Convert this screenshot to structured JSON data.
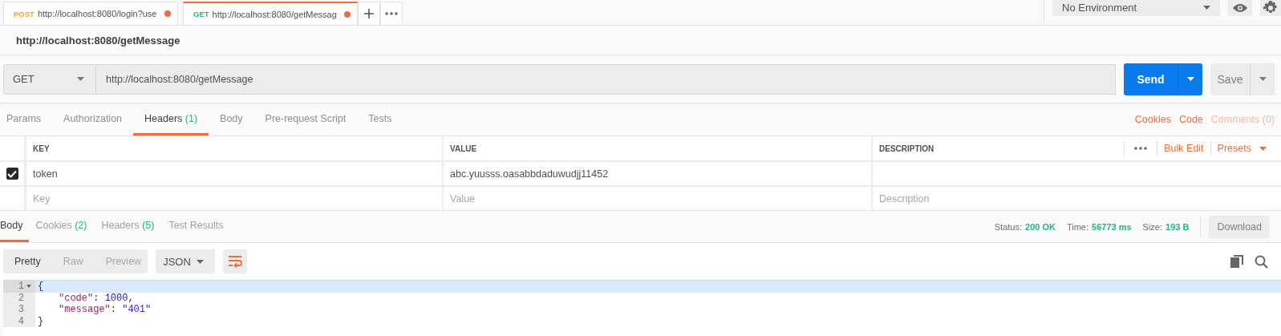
{
  "tabs": [
    {
      "method": "POST",
      "color": "#f5a623",
      "url": "http://localhost:8080/login?use",
      "unsaved": true,
      "selected": false
    },
    {
      "method": "GET",
      "color": "#26b47f",
      "url": "http://localhost:8080/getMessag",
      "unsaved": true,
      "selected": true
    }
  ],
  "environment": {
    "value": "No Environment"
  },
  "request": {
    "title": "http://localhost:8080/getMessage",
    "method": "GET",
    "url": "http://localhost:8080/getMessage",
    "send": "Send",
    "save": "Save"
  },
  "request_tabs": [
    {
      "label": "Params",
      "selected": false
    },
    {
      "label": "Authorization",
      "selected": false
    },
    {
      "label": "Headers",
      "count": "(1)",
      "selected": true
    },
    {
      "label": "Body",
      "selected": false
    },
    {
      "label": "Pre-request Script",
      "selected": false
    },
    {
      "label": "Tests",
      "selected": false
    }
  ],
  "request_links": [
    {
      "label": "Cookies",
      "disabled": false
    },
    {
      "label": "Code",
      "disabled": false
    },
    {
      "label": "Comments (0)",
      "disabled": true
    }
  ],
  "headers_table": {
    "columns": [
      "KEY",
      "VALUE",
      "DESCRIPTION"
    ],
    "bulk_edit": "Bulk Edit",
    "presets": "Presets",
    "rows": [
      {
        "checked": true,
        "key": "token",
        "value": "abc.yuusss.oasabbdaduwudjj11452"
      }
    ],
    "new_row": {
      "key_placeholder": "Key",
      "value_placeholder": "Value",
      "description_placeholder": "Description"
    }
  },
  "response_tabs": [
    {
      "label": "Body",
      "selected": true
    },
    {
      "label": "Cookies",
      "count": "(2)",
      "selected": false
    },
    {
      "label": "Headers",
      "count": "(5)",
      "selected": false
    },
    {
      "label": "Test Results",
      "selected": false
    }
  ],
  "response_stats": [
    {
      "label": "Status:",
      "value": "200 OK"
    },
    {
      "label": "Time:",
      "value": "56773 ms"
    },
    {
      "label": "Size:",
      "value": "193 B"
    }
  ],
  "download": "Download",
  "view_modes": [
    {
      "label": "Pretty",
      "selected": true
    },
    {
      "label": "Raw",
      "selected": false
    },
    {
      "label": "Preview",
      "selected": false
    }
  ],
  "format": "JSON",
  "code_lines": [
    {
      "number": "1",
      "foldable": true,
      "highlighted": true,
      "indented": false,
      "tokens": [
        {
          "kind": "punct",
          "text": "{"
        }
      ]
    },
    {
      "number": "2",
      "foldable": false,
      "highlighted": false,
      "indented": true,
      "tokens": [
        {
          "kind": "key",
          "text": "\"code\""
        },
        {
          "kind": "punct",
          "text": ": "
        },
        {
          "kind": "number",
          "text": "1000"
        },
        {
          "kind": "punct",
          "text": ","
        }
      ]
    },
    {
      "number": "3",
      "foldable": false,
      "highlighted": false,
      "indented": true,
      "tokens": [
        {
          "kind": "key",
          "text": "\"message\""
        },
        {
          "kind": "punct",
          "text": ": "
        },
        {
          "kind": "string",
          "text": "\"401\""
        }
      ]
    },
    {
      "number": "4",
      "foldable": false,
      "highlighted": false,
      "indented": false,
      "tokens": [
        {
          "kind": "punct",
          "text": "}"
        }
      ]
    }
  ]
}
